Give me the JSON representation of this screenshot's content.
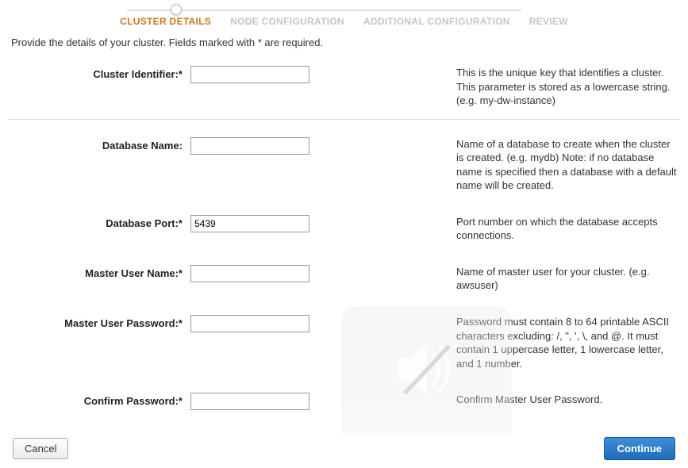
{
  "stepper": {
    "steps": [
      {
        "label": "CLUSTER DETAILS",
        "active": true
      },
      {
        "label": "NODE CONFIGURATION",
        "active": false
      },
      {
        "label": "ADDITIONAL CONFIGURATION",
        "active": false
      },
      {
        "label": "REVIEW",
        "active": false
      }
    ]
  },
  "intro": "Provide the details of your cluster. Fields marked with * are required.",
  "fields": {
    "cluster_identifier": {
      "label": "Cluster Identifier:*",
      "value": "",
      "help": "This is the unique key that identifies a cluster. This parameter is stored as a lowercase string. (e.g. my-dw-instance)"
    },
    "database_name": {
      "label": "Database Name:",
      "value": "",
      "help": "Name of a database to create when the cluster is created. (e.g. mydb) Note: if no database name is specified then a database with a default name will be created."
    },
    "database_port": {
      "label": "Database Port:*",
      "value": "5439",
      "help": "Port number on which the database accepts connections."
    },
    "master_user_name": {
      "label": "Master User Name:*",
      "value": "",
      "help": "Name of master user for your cluster. (e.g. awsuser)"
    },
    "master_user_password": {
      "label": "Master User Password:*",
      "value": "",
      "help": "Password must contain 8 to 64 printable ASCII characters excluding: /, \", ', \\, and @. It must contain 1 uppercase letter, 1 lowercase letter, and 1 number."
    },
    "confirm_password": {
      "label": "Confirm Password:*",
      "value": "",
      "help": "Confirm Master User Password."
    }
  },
  "actions": {
    "cancel": "Cancel",
    "continue": "Continue"
  }
}
